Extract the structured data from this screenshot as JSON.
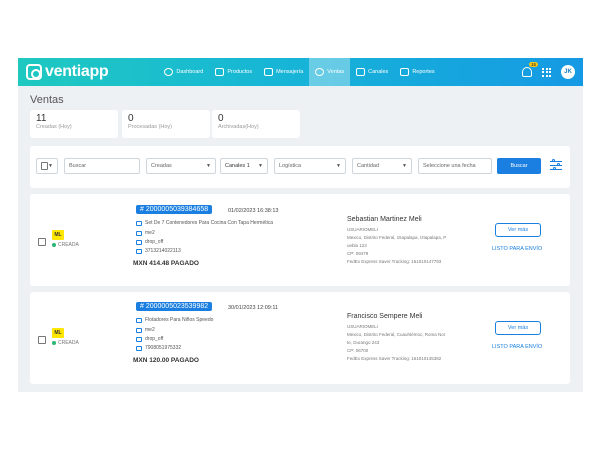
{
  "app": {
    "logo_text": "ventiapp",
    "page_title": "Ventas"
  },
  "nav": [
    {
      "label": "Dashboard",
      "icon": "cloud-icon"
    },
    {
      "label": "Productos",
      "icon": "box-icon"
    },
    {
      "label": "Mensajería",
      "icon": "paper-plane-icon"
    },
    {
      "label": "Ventas",
      "icon": "dollar-icon",
      "active": true
    },
    {
      "label": "Canales",
      "icon": "monitor-icon"
    },
    {
      "label": "Reportes",
      "icon": "chart-icon"
    }
  ],
  "topbar": {
    "notification_count": "15",
    "user_initials": "JK"
  },
  "stats": [
    {
      "value": "11",
      "label": "Creadas (Hoy)"
    },
    {
      "value": "0",
      "label": "Procesadas (Hoy)"
    },
    {
      "value": "0",
      "label": "Archivadas(Hoy)"
    }
  ],
  "filters": {
    "search_placeholder": "Buscar",
    "status": "Creadas",
    "channels": "Canales 1",
    "logistics": "Logística",
    "quantity": "Cantidad",
    "date_placeholder": "Seleccione una fecha",
    "search_button": "Buscar"
  },
  "orders": [
    {
      "channel_badge": "ML",
      "status": "CREADA",
      "id": "# 2000005039384658",
      "date": "01/02/2023 16:38:13",
      "product": "Set De 7 Contenedores Para Cocina Con Tapa Hermética",
      "sku": "me2",
      "logistic": "drop_off",
      "tracking_code": "3713214022113",
      "amount": "MXN 414.48 PAGADO",
      "customer_name": "Sebastian Martinez Meli",
      "customer_user": "USUARIOMELI",
      "address1": "Mexico, Distrito Federal, Iztapalapa, Iztapalapa, P",
      "address2": "uebla 123",
      "postal": "CP: 09479",
      "carrier": "FedEx Express Saver Tracking: 161010147793",
      "details_button": "Ver más",
      "shipping_status": "LISTO PARA ENVÍO"
    },
    {
      "channel_badge": "ML",
      "status": "CREADA",
      "id": "# 2000005023539982",
      "date": "30/01/2023 12:09:11",
      "product": "Flotadores Para Niños Speedo",
      "sku": "me2",
      "logistic": "drop_off",
      "tracking_code": "7908051975332",
      "amount": "MXN 120.00 PAGADO",
      "customer_name": "Francisco Sempere Meli",
      "customer_user": "USUARIOMELI",
      "address1": "Mexico, Distrito Federal, Cuauhtémoc, Roma Nor",
      "address2": "te, Durango 243",
      "postal": "CP: 06700",
      "carrier": "FedEx Express Saver Tracking: 161010145382",
      "details_button": "Ver más",
      "shipping_status": "LISTO PARA ENVÍO"
    }
  ]
}
